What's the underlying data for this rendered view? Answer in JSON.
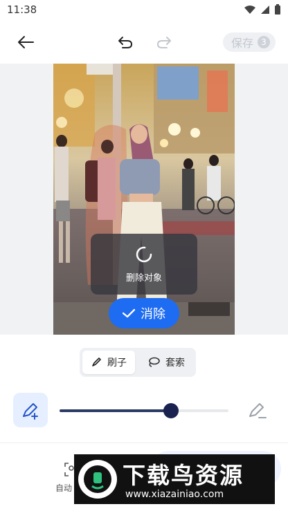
{
  "status_bar": {
    "time": "11:38"
  },
  "toolbar": {
    "save_label": "保存",
    "save_count": "3"
  },
  "overlay": {
    "text": "删除对象"
  },
  "apply_button": {
    "label": "消除"
  },
  "mode_toggle": {
    "brush_label": "刷子",
    "lasso_label": "套索",
    "selected": "刷子"
  },
  "brush_size": {
    "value_fraction": 0.66
  },
  "bottom": {
    "auto_label": "自动"
  },
  "watermark": {
    "title": "下载鸟资源",
    "url": "www.xiazainiao.com"
  },
  "colors": {
    "accent": "#1e6cf2",
    "slider_knob": "#1a2250",
    "overlay": "#37373e"
  }
}
